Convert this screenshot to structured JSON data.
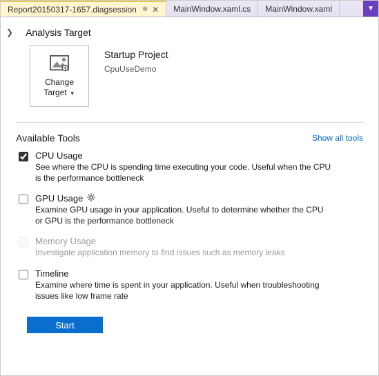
{
  "tabs": {
    "active": "Report20150317-1657.diagsession",
    "inactive1": "MainWindow.xaml.cs",
    "inactive2": "MainWindow.xaml"
  },
  "analysis": {
    "section_title": "Analysis Target",
    "change_target_label": "Change Target",
    "startup_title": "Startup Project",
    "startup_name": "CpuUseDemo"
  },
  "tools_section": {
    "title": "Available Tools",
    "show_all": "Show all tools"
  },
  "tools": {
    "cpu": {
      "name": "CPU Usage",
      "desc": "See where the CPU is spending time executing your code. Useful when the CPU is the performance bottleneck"
    },
    "gpu": {
      "name": "GPU Usage",
      "desc": "Examine GPU usage in your application. Useful to determine whether the CPU or GPU is the performance bottleneck"
    },
    "memory": {
      "name": "Memory Usage",
      "desc": "Investigate application memory to find issues such as memory leaks"
    },
    "timeline": {
      "name": "Timeline",
      "desc": "Examine where time is spent in your application. Useful when troubleshooting issues like low frame rate"
    }
  },
  "start_label": "Start"
}
